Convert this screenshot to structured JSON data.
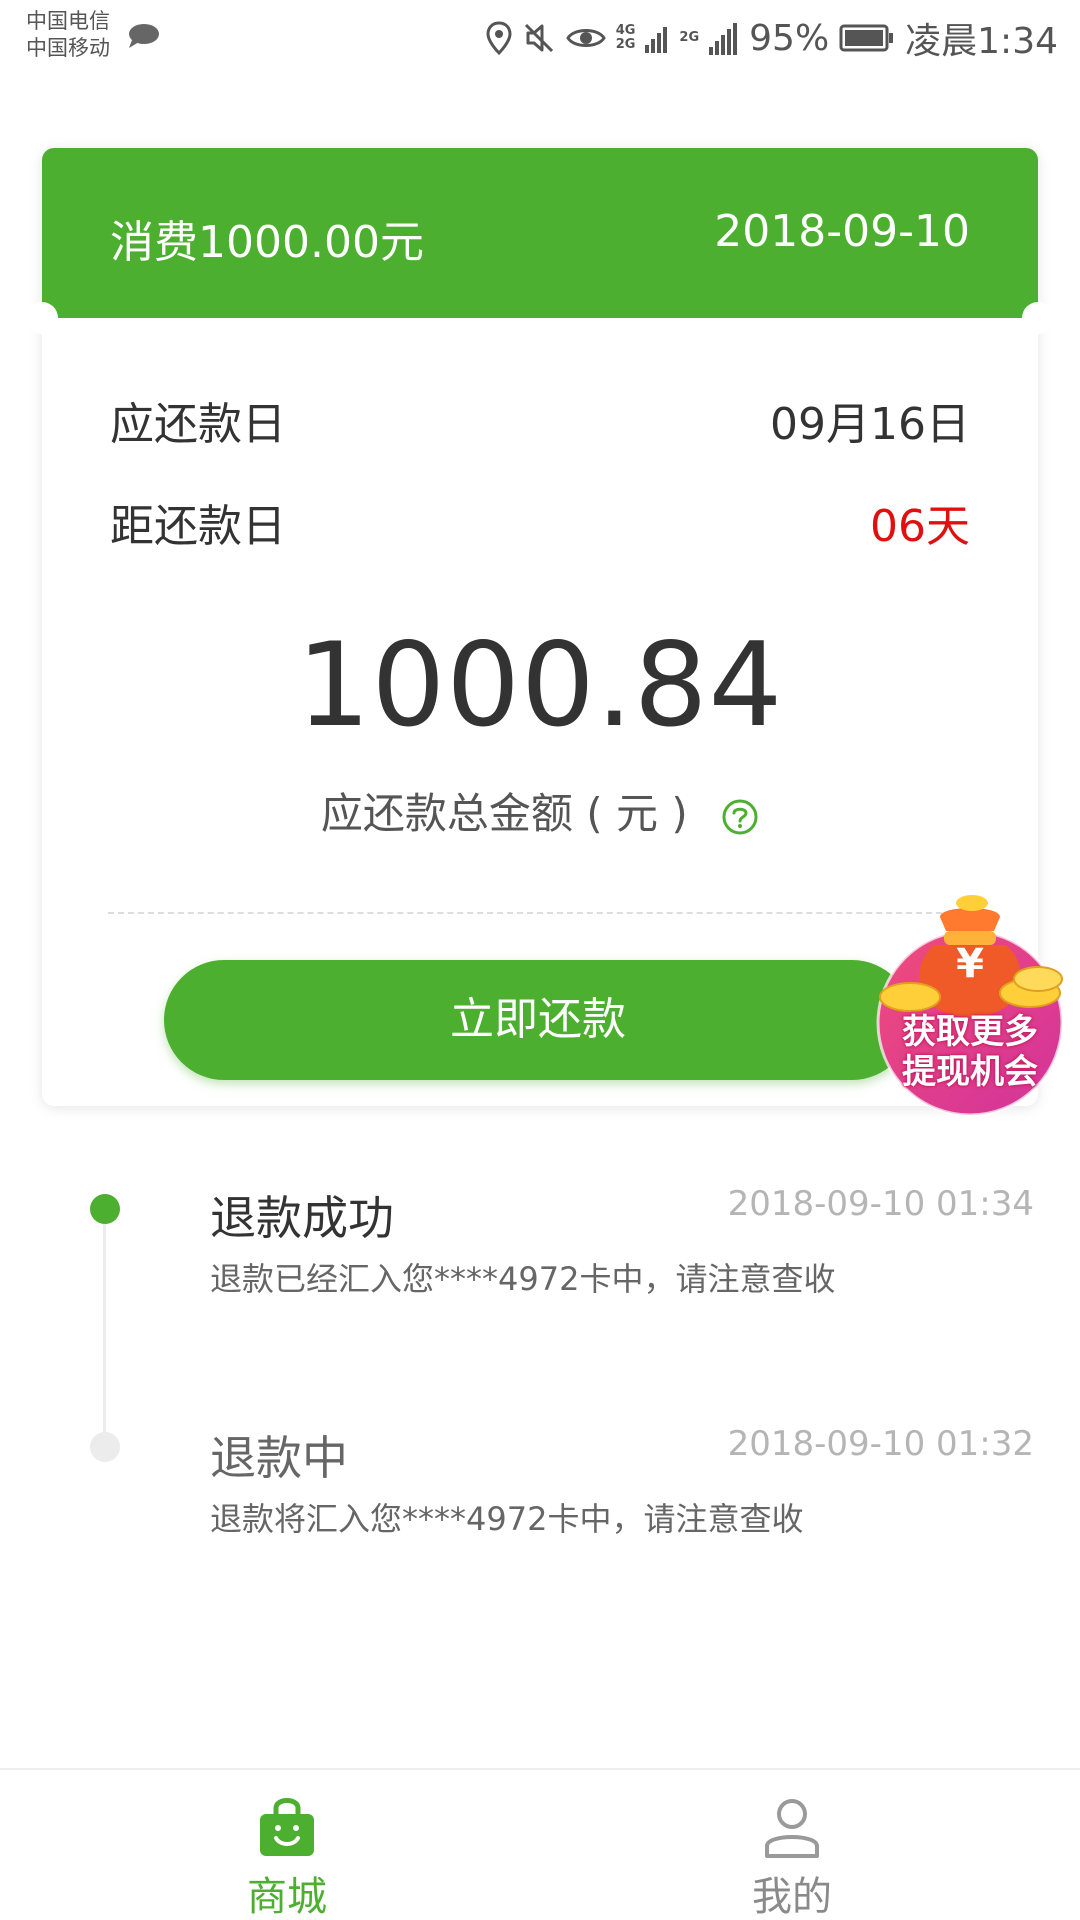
{
  "status_bar": {
    "carrier_1": "中国电信",
    "carrier_2": "中国移动",
    "network_1": "4G",
    "network_1_sub": "2G",
    "network_2": "2G",
    "battery": "95%",
    "time": "凌晨1:34",
    "icons": [
      "message-icon",
      "location-icon",
      "mute-icon",
      "eye-icon",
      "signal-icon",
      "battery-icon"
    ]
  },
  "card": {
    "header_title": "消费1000.00元",
    "header_date": "2018-09-10",
    "due_label": "应还款日",
    "due_value": "09月16日",
    "remain_label": "距还款日",
    "remain_value": "06天",
    "amount": "1000.84",
    "amount_label": "应还款总金额 ( 元 )",
    "pay_button": "立即还款"
  },
  "promo": {
    "line_1": "获取更多",
    "line_2": "提现机会",
    "symbol": "¥"
  },
  "timeline": [
    {
      "title": "退款成功",
      "time": "2018-09-10 01:34",
      "desc": "退款已经汇入您****4972卡中，请注意查收",
      "active": true
    },
    {
      "title": "退款中",
      "time": "2018-09-10 01:32",
      "desc": "退款将汇入您****4972卡中，请注意查收",
      "active": false
    }
  ],
  "bottom_nav": {
    "shop_label": "商城",
    "mine_label": "我的"
  },
  "colors": {
    "accent": "#4caf2f",
    "warning": "#e01010",
    "promo": "#e8347a"
  }
}
